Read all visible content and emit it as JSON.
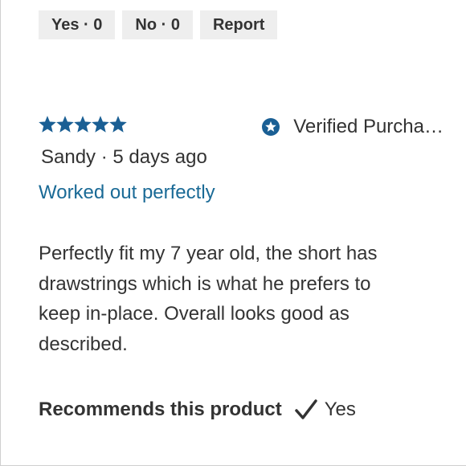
{
  "feedback": {
    "yes_label": "Yes · 0",
    "no_label": "No · 0",
    "report_label": "Report"
  },
  "review": {
    "rating": 5,
    "rating_max": 5,
    "verified_label": "Verified Purcha…",
    "author": "Sandy",
    "date": "· 5 days ago",
    "title": "Worked out perfectly",
    "body": "Perfectly fit my 7 year old, the short has drawstrings which is what he prefers to keep in-place. Overall looks good as described.",
    "recommend_label": "Recommends this product",
    "recommend_value": "Yes"
  },
  "colors": {
    "star": "#1a5f94",
    "title": "#1a6a96",
    "verified_badge": "#1a5f94",
    "button_bg": "#eeeeee",
    "text": "#333333"
  },
  "icons": {
    "star": "star-icon",
    "verified": "verified-badge-icon",
    "check": "check-icon"
  }
}
